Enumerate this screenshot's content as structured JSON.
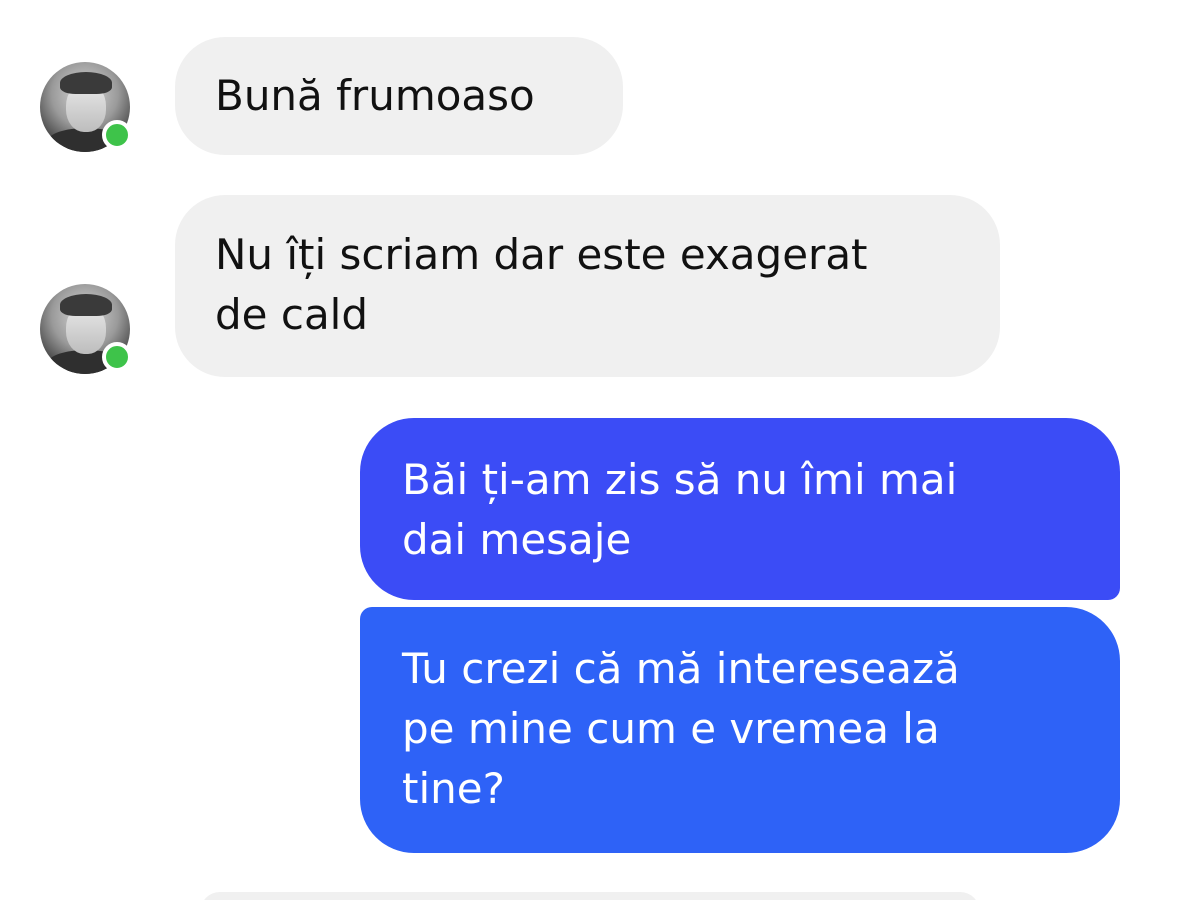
{
  "messages": [
    {
      "direction": "incoming",
      "text_lines": [
        "Bună frumoaso"
      ]
    },
    {
      "direction": "incoming",
      "text_lines": [
        "Nu îți scriam dar este exagerat",
        "de cald"
      ]
    },
    {
      "direction": "outgoing",
      "text_lines": [
        "Băi ți-am zis să nu îmi mai",
        "dai mesaje"
      ]
    },
    {
      "direction": "outgoing",
      "text_lines": [
        "Tu crezi că mă interesează",
        "pe mine cum e vremea la",
        "tine?"
      ]
    }
  ],
  "contact": {
    "avatar_icon": "profile-photo",
    "status_icon": "online-dot",
    "status_color": "#3ec34a"
  },
  "colors": {
    "incoming_bubble": "#f0f0f0",
    "outgoing_bubble_1": "#3b4cf6",
    "outgoing_bubble_2": "#2e62f7"
  }
}
